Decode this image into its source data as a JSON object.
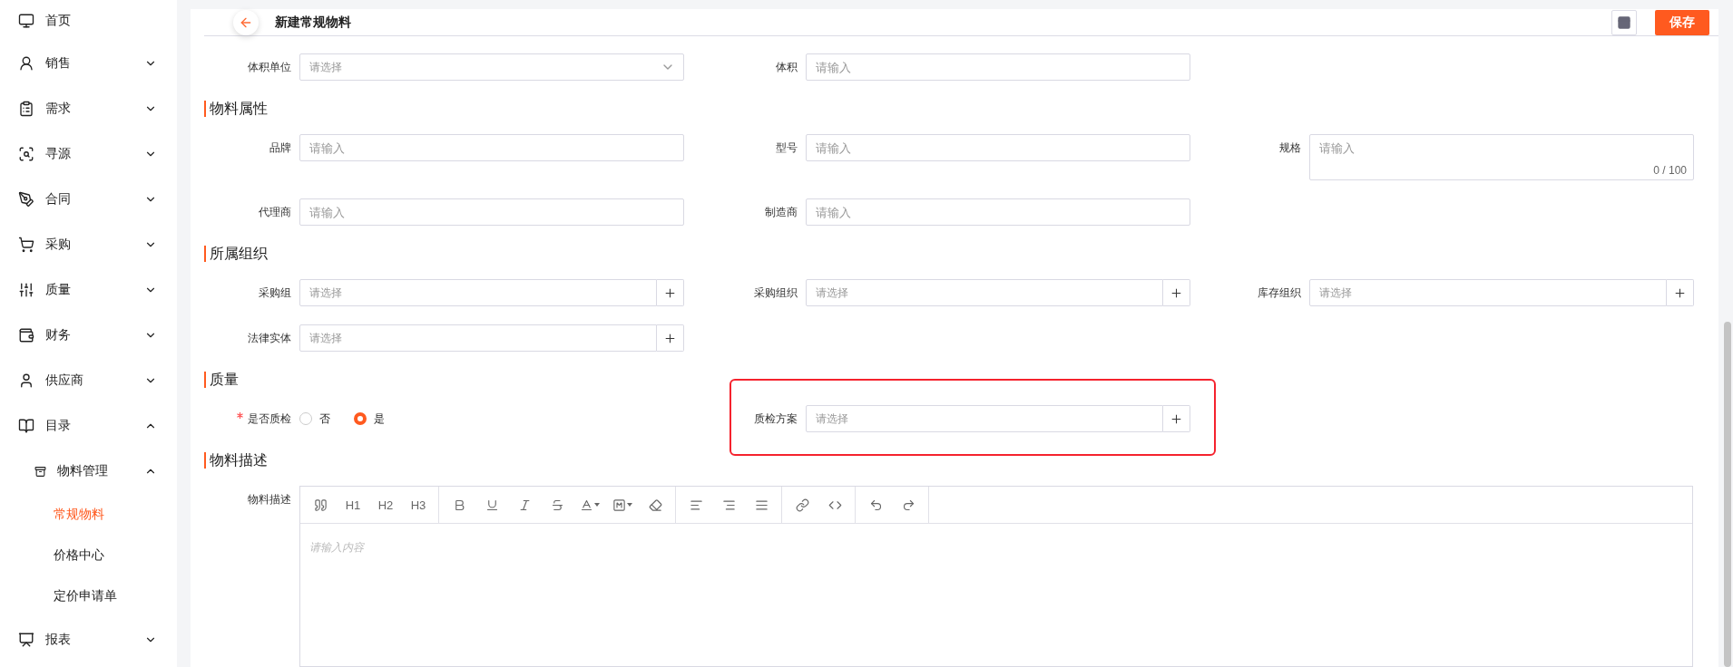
{
  "sidebar": {
    "items": [
      {
        "label": "首页"
      },
      {
        "label": "销售",
        "expanded": false
      },
      {
        "label": "需求",
        "expanded": false
      },
      {
        "label": "寻源",
        "expanded": false
      },
      {
        "label": "合同",
        "expanded": false
      },
      {
        "label": "采购",
        "expanded": false
      },
      {
        "label": "质量",
        "expanded": false
      },
      {
        "label": "财务",
        "expanded": false
      },
      {
        "label": "供应商",
        "expanded": false
      },
      {
        "label": "目录",
        "expanded": true,
        "children": [
          {
            "label": "物料管理",
            "expanded": true,
            "children": [
              {
                "label": "常规物料",
                "selected": true
              },
              {
                "label": "价格中心",
                "selected": false
              },
              {
                "label": "定价申请单",
                "selected": false
              }
            ]
          }
        ]
      },
      {
        "label": "报表",
        "expanded": false
      }
    ]
  },
  "page": {
    "title": "新建常规物料",
    "save_button": "保存"
  },
  "sections": [
    {
      "fields": [
        {
          "label": "体积单位",
          "kind": "select",
          "placeholder": "请选择"
        },
        {
          "label": "体积",
          "kind": "input",
          "placeholder": "请输入"
        }
      ]
    },
    {
      "title": "物料属性",
      "fields": [
        {
          "label": "品牌",
          "kind": "input",
          "placeholder": "请输入"
        },
        {
          "label": "型号",
          "kind": "input",
          "placeholder": "请输入"
        },
        {
          "label": "规格",
          "kind": "textarea",
          "placeholder": "请输入",
          "counter": "0 / 100"
        },
        {
          "label": "代理商",
          "kind": "input",
          "placeholder": "请输入"
        },
        {
          "label": "制造商",
          "kind": "input",
          "placeholder": "请输入"
        }
      ]
    },
    {
      "title": "所属组织",
      "fields": [
        {
          "label": "采购组",
          "kind": "picker",
          "placeholder": "请选择"
        },
        {
          "label": "采购组织",
          "kind": "picker",
          "placeholder": "请选择"
        },
        {
          "label": "库存组织",
          "kind": "picker",
          "placeholder": "请选择"
        },
        {
          "label": "法律实体",
          "kind": "picker",
          "placeholder": "请选择"
        }
      ]
    },
    {
      "title": "质量",
      "fields": [
        {
          "label": "是否质检",
          "kind": "radio",
          "required": true,
          "options": [
            {
              "label": "否",
              "selected": false
            },
            {
              "label": "是",
              "selected": true
            }
          ]
        },
        {
          "label": "质检方案",
          "kind": "picker",
          "placeholder": "请选择",
          "highlighted": true
        }
      ]
    },
    {
      "title": "物料描述",
      "fields": [
        {
          "label": "物料描述",
          "kind": "editor",
          "placeholder": "请输入内容",
          "toolbar": [
            [
              {
                "kind": "quote"
              },
              {
                "kind": "text",
                "label": "H1"
              },
              {
                "kind": "text",
                "label": "H2"
              },
              {
                "kind": "text",
                "label": "H3"
              }
            ],
            [
              {
                "kind": "bold"
              },
              {
                "kind": "underline"
              },
              {
                "kind": "italic"
              },
              {
                "kind": "strike"
              },
              {
                "kind": "font-color"
              },
              {
                "kind": "back-color"
              },
              {
                "kind": "eraser"
              }
            ],
            [
              {
                "kind": "align-left"
              },
              {
                "kind": "align-right"
              },
              {
                "kind": "align-justify"
              }
            ],
            [
              {
                "kind": "link"
              },
              {
                "kind": "code"
              }
            ],
            [
              {
                "kind": "undo"
              },
              {
                "kind": "redo"
              }
            ]
          ]
        }
      ]
    }
  ]
}
